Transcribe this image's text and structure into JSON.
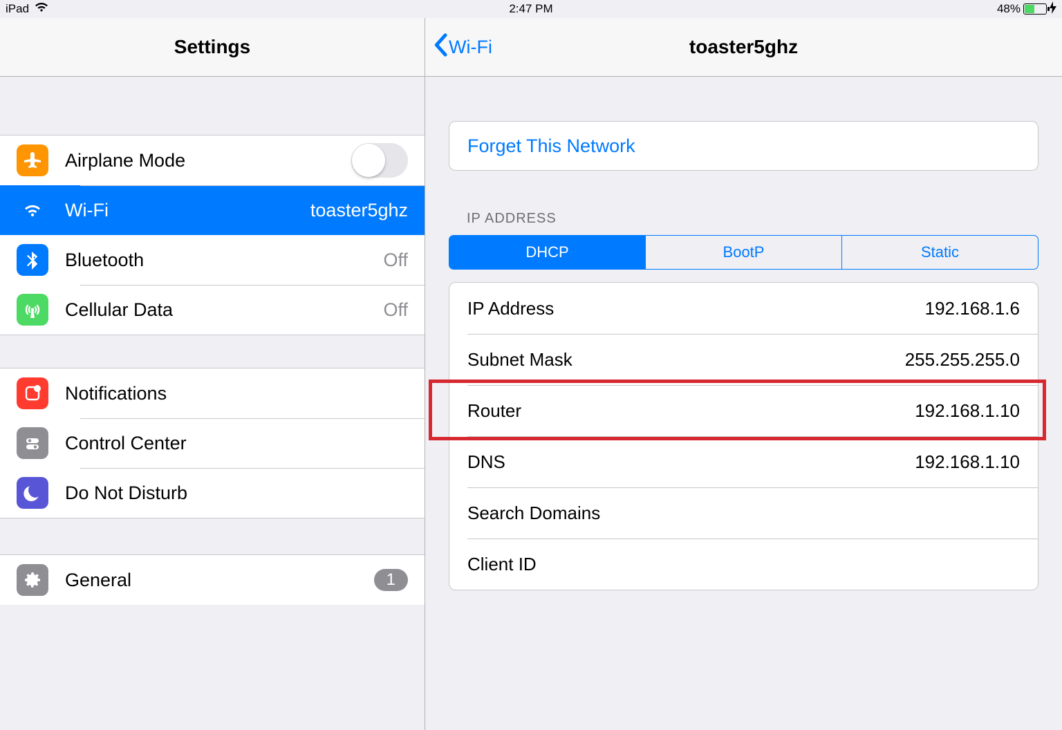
{
  "statusbar": {
    "device": "iPad",
    "time": "2:47 PM",
    "battery_text": "48%",
    "battery_pct": 48
  },
  "sidebar": {
    "title": "Settings",
    "groups": [
      {
        "rows": [
          {
            "id": "airplane",
            "label": "Airplane Mode",
            "tail": "",
            "selected": false,
            "has_switch": true
          },
          {
            "id": "wifi",
            "label": "Wi-Fi",
            "tail": "toaster5ghz",
            "selected": true
          },
          {
            "id": "bluetooth",
            "label": "Bluetooth",
            "tail": "Off",
            "selected": false
          },
          {
            "id": "cellular",
            "label": "Cellular Data",
            "tail": "Off",
            "selected": false
          }
        ]
      },
      {
        "rows": [
          {
            "id": "notifications",
            "label": "Notifications",
            "tail": "",
            "selected": false
          },
          {
            "id": "controlcenter",
            "label": "Control Center",
            "tail": "",
            "selected": false
          },
          {
            "id": "dnd",
            "label": "Do Not Disturb",
            "tail": "",
            "selected": false
          }
        ]
      },
      {
        "rows": [
          {
            "id": "general",
            "label": "General",
            "badge": "1",
            "selected": false
          }
        ]
      }
    ]
  },
  "detail": {
    "back_label": "Wi-Fi",
    "title": "toaster5ghz",
    "forget_label": "Forget This Network",
    "ip_section_header": "IP ADDRESS",
    "seg": {
      "items": [
        "DHCP",
        "BootP",
        "Static"
      ],
      "selected_index": 0
    },
    "rows": [
      {
        "k": "IP Address",
        "v": "192.168.1.6"
      },
      {
        "k": "Subnet Mask",
        "v": "255.255.255.0"
      },
      {
        "k": "Router",
        "v": "192.168.1.10"
      },
      {
        "k": "DNS",
        "v": "192.168.1.10"
      },
      {
        "k": "Search Domains",
        "v": ""
      },
      {
        "k": "Client ID",
        "v": ""
      }
    ],
    "highlight_row_index": 2
  },
  "colors": {
    "accent": "#007aff",
    "highlight_border": "#d7282f"
  }
}
